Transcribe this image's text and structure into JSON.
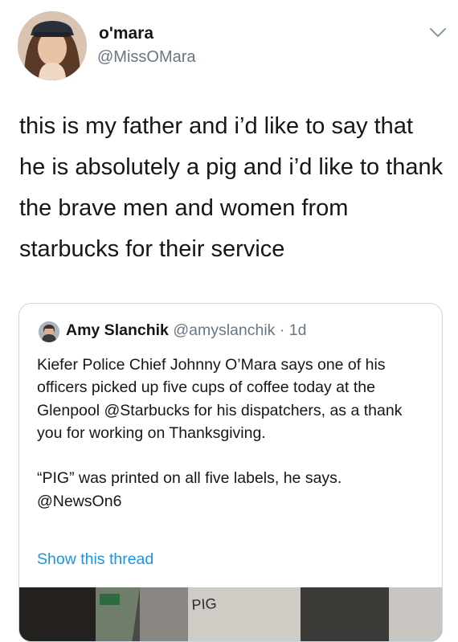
{
  "tweet": {
    "display_name": "o'mara",
    "handle": "@MissOMara",
    "text": "this is my father and i’d like to say that he is absolutely a pig and i’d like to thank the brave men and women from starbucks for their service"
  },
  "quoted_tweet": {
    "display_name": "Amy Slanchik",
    "handle": "@amyslanchik",
    "separator": " · ",
    "age": "1d",
    "text": "Kiefer Police Chief Johnny O’Mara says one of his officers picked up five cups of coffee today at the Glenpool @Starbucks for his dispatchers, as a thank you for working on Thanksgiving.\n\n“PIG” was printed on all five labels, he says. @NewsOn6",
    "show_thread": "Show this thread",
    "media_label_text": "PIG"
  },
  "colors": {
    "text": "#14171a",
    "secondary": "#657786",
    "link": "#1b95e0",
    "border": "#ccd6dd"
  },
  "icons": {
    "menu": "chevron-down-icon"
  }
}
